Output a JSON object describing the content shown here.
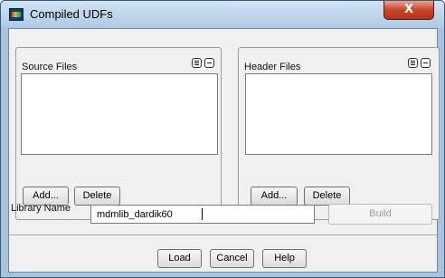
{
  "window": {
    "title": "Compiled UDFs",
    "close_glyph": "X",
    "icon": "fluent-app-icon"
  },
  "source_files": {
    "label": "Source Files",
    "items": [],
    "add_label": "Add...",
    "delete_label": "Delete"
  },
  "header_files": {
    "label": "Header Files",
    "items": [],
    "add_label": "Add...",
    "delete_label": "Delete"
  },
  "library": {
    "label": "Library Name",
    "value": "mdmlib_dardik60",
    "build_label": "Build"
  },
  "footer": {
    "load_label": "Load",
    "cancel_label": "Cancel",
    "help_label": "Help"
  },
  "colors": {
    "frame": "#a9c3de",
    "client": "#f0f0f0",
    "close": "#c8452b"
  }
}
